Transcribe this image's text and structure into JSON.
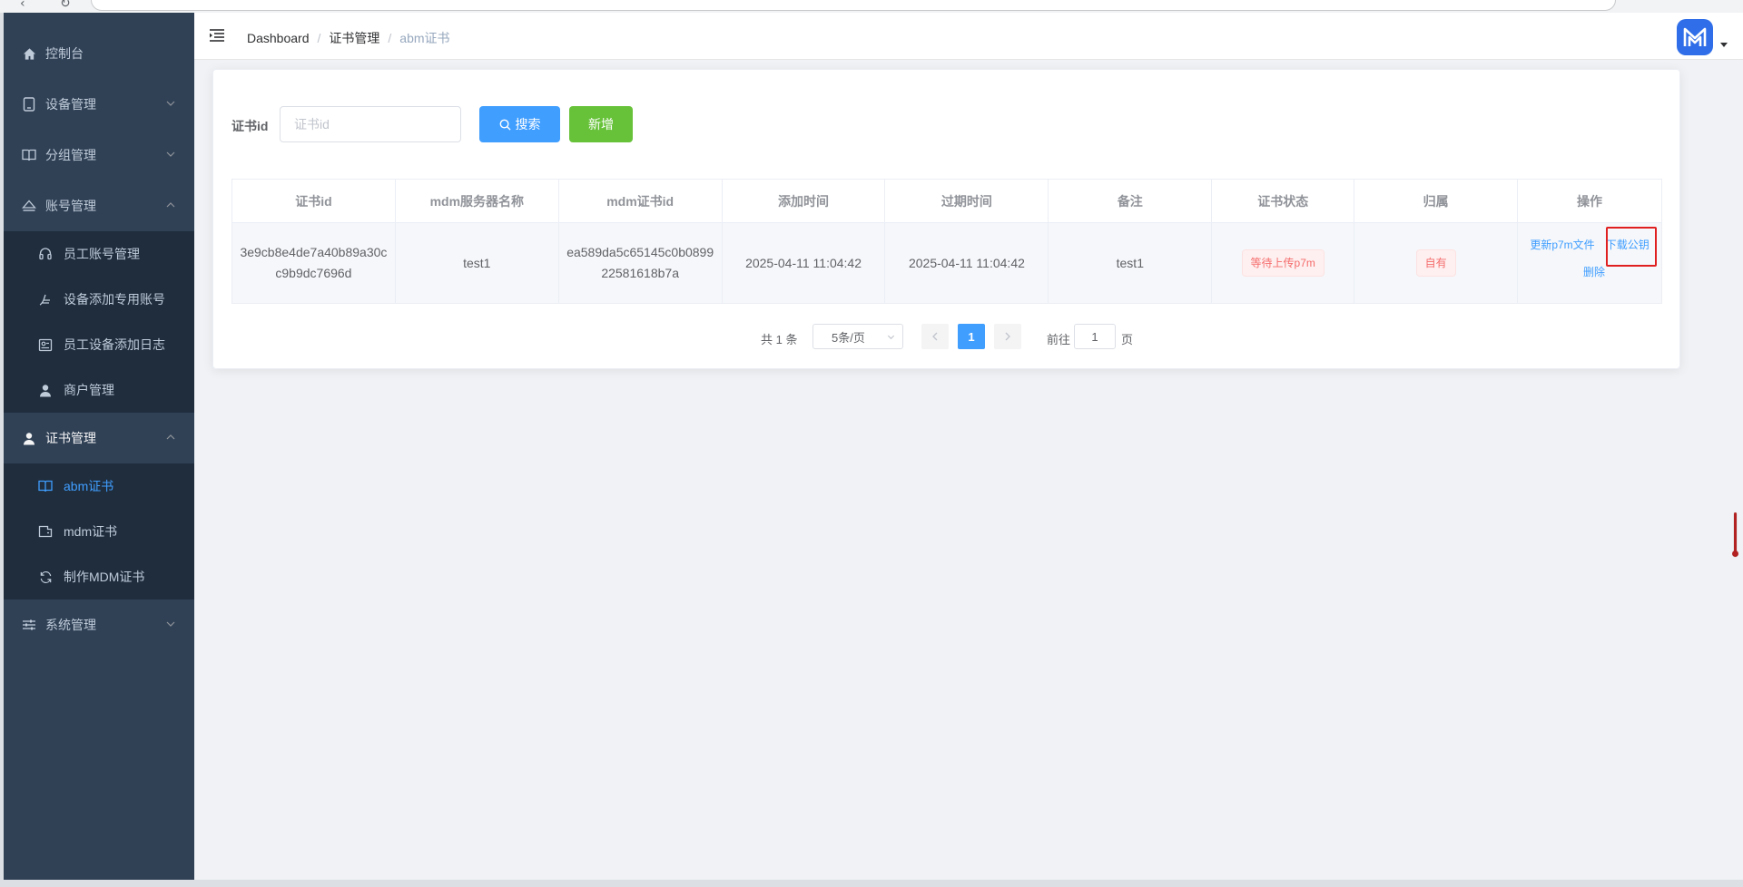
{
  "sidebar": {
    "items": [
      {
        "label": "控制台",
        "icon": "home-icon"
      },
      {
        "label": "设备管理",
        "icon": "device-icon"
      },
      {
        "label": "分组管理",
        "icon": "book-icon"
      },
      {
        "label": "账号管理",
        "icon": "eject-icon"
      },
      {
        "label": "证书管理",
        "icon": "user-icon"
      },
      {
        "label": "系统管理",
        "icon": "sliders-icon"
      }
    ],
    "account_sub": [
      {
        "label": "员工账号管理",
        "icon": "headset-icon"
      },
      {
        "label": "设备添加专用账号",
        "icon": "hand-icon"
      },
      {
        "label": "员工设备添加日志",
        "icon": "id-card-icon"
      },
      {
        "label": "商户管理",
        "icon": "person-icon"
      }
    ],
    "cert_sub": [
      {
        "label": "abm证书",
        "icon": "book-icon",
        "active": true
      },
      {
        "label": "mdm证书",
        "icon": "wallet-icon"
      },
      {
        "label": "制作MDM证书",
        "icon": "refresh-icon"
      }
    ]
  },
  "navbar": {
    "breadcrumb": [
      "Dashboard",
      "证书管理",
      "abm证书"
    ],
    "avatar_color": "#2f6ee8"
  },
  "search": {
    "label": "证书id",
    "placeholder": "证书id",
    "value": "",
    "search_button": "搜索",
    "add_button": "新增"
  },
  "table": {
    "headers": [
      "证书id",
      "mdm服务器名称",
      "mdm证书id",
      "添加时间",
      "过期时间",
      "备注",
      "证书状态",
      "归属",
      "操作"
    ],
    "rows": [
      {
        "cert_id": "3e9cb8e4de7a40b89a30cc9b9dc7696d",
        "server_name": "test1",
        "mdm_cert_id": "ea589da5c65145c0b089922581618b7a",
        "added": "2025-04-11 11:04:42",
        "expires": "2025-04-11 11:04:42",
        "note": "test1",
        "status": "等待上传p7m",
        "owner": "自有",
        "actions": {
          "update": "更新p7m文件",
          "download": "下载公钥",
          "delete": "删除"
        }
      }
    ]
  },
  "pagination": {
    "total": "共 1 条",
    "page_size": "5条/页",
    "current": "1",
    "goto_label": "前往",
    "goto_value": "1",
    "page_suffix": "页"
  }
}
